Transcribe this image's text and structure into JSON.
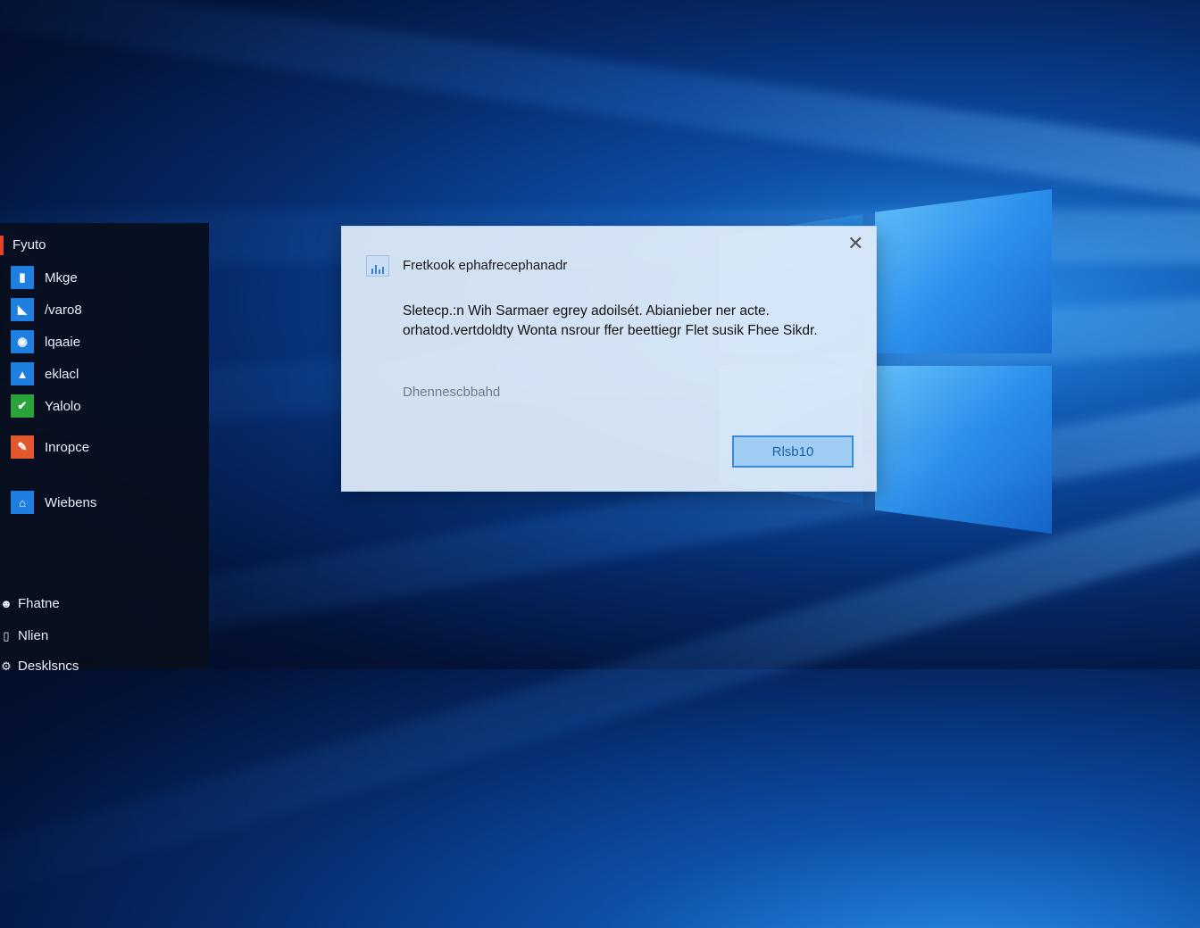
{
  "start_menu": {
    "header": "Fyuto",
    "items": [
      {
        "label": "Mkge",
        "icon": "app-tile-icon",
        "color": "#1e7fe0"
      },
      {
        "label": "/varo8",
        "icon": "app-tile-icon",
        "color": "#1e7fe0"
      },
      {
        "label": "lqaaie",
        "icon": "app-tile-icon",
        "color": "#1e7fe0"
      },
      {
        "label": "eklacl",
        "icon": "app-tile-icon",
        "color": "#1e7fe0"
      },
      {
        "label": "Yalolo",
        "icon": "app-tile-icon",
        "color": "#2aa33a"
      },
      {
        "label": "Inropce",
        "icon": "app-tile-icon",
        "color": "#e2572b"
      },
      {
        "label": "Wiebens",
        "icon": "app-tile-icon",
        "color": "#1e7fe0"
      }
    ],
    "bottom_items": [
      {
        "label": "Fhatne",
        "icon": "user-icon"
      },
      {
        "label": "Nlien",
        "icon": "document-icon"
      },
      {
        "label": "Desklsncs",
        "icon": "settings-icon"
      }
    ]
  },
  "dialog": {
    "title": "Fretkook ephafrecephanadr",
    "message": "Sletecp.:n Wih Sarmaer egrey adoilsét. Abianieber ner acte. orhatod.vertdoldty Wonta nsrour ffer beettiegr Flet susik Fhee Sikdr.",
    "note": "Dhennescbbahd",
    "button_label": "Rlsb10",
    "close_icon": "close-icon",
    "app_icon": "app-icon"
  }
}
